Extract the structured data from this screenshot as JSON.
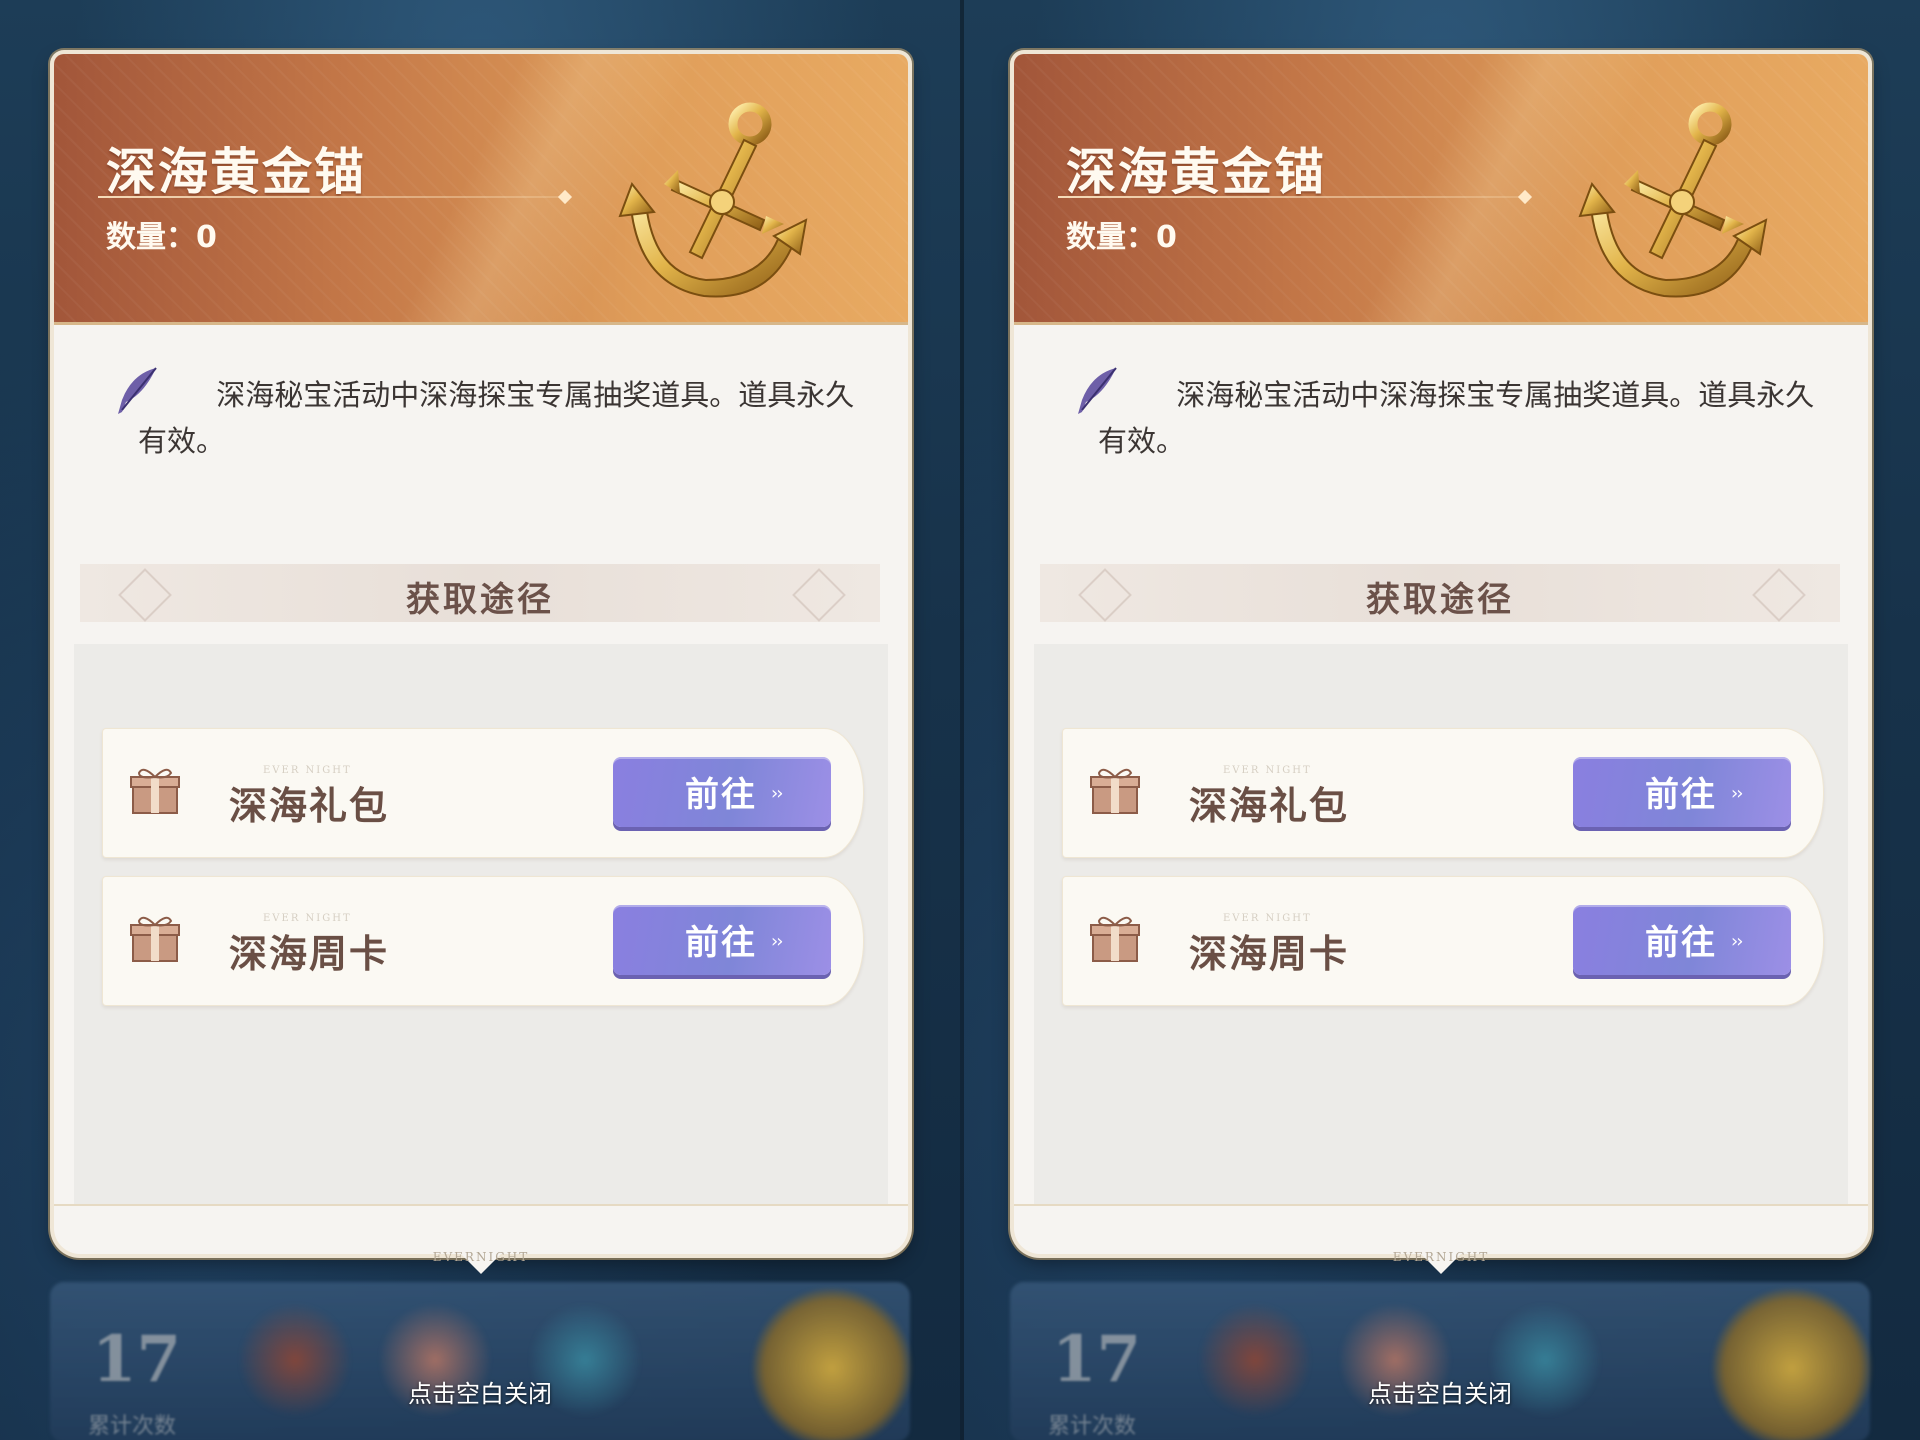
{
  "panels": [
    {
      "item": {
        "title": "深海黄金锚",
        "quantity_label": "数量：",
        "quantity": "0"
      },
      "description": "深海秘宝活动中深海探宝专属抽奖道具。道具永久有效。",
      "section_title": "获取途径",
      "sources": [
        {
          "label": "深海礼包",
          "button": "前往",
          "watermark": "EVER NIGHT"
        },
        {
          "label": "深海周卡",
          "button": "前往",
          "watermark": "EVER NIGHT"
        }
      ],
      "footer_brand": "EVERNIGHT",
      "close_hint": "点击空白关闭",
      "background": {
        "counter_value": "17",
        "counter_label": "累计次数"
      }
    },
    {
      "item": {
        "title": "深海黄金锚",
        "quantity_label": "数量：",
        "quantity": "0"
      },
      "description": "深海秘宝活动中深海探宝专属抽奖道具。道具永久有效。",
      "section_title": "获取途径",
      "sources": [
        {
          "label": "深海礼包",
          "button": "前往",
          "watermark": "EVER NIGHT"
        },
        {
          "label": "深海周卡",
          "button": "前往",
          "watermark": "EVER NIGHT"
        }
      ],
      "footer_brand": "EVERNIGHT",
      "close_hint": "点击空白关闭",
      "background": {
        "counter_value": "17",
        "counter_label": "累计次数"
      }
    }
  ],
  "colors": {
    "header_start": "#a2563a",
    "header_end": "#e8aa62",
    "button": "#8a7fe0",
    "card": "#f6f4f1",
    "label_text": "#6a4f45"
  },
  "icons": [
    "anchor-icon",
    "feather-quill-icon",
    "gift-box-icon",
    "double-chevron-right-icon"
  ]
}
